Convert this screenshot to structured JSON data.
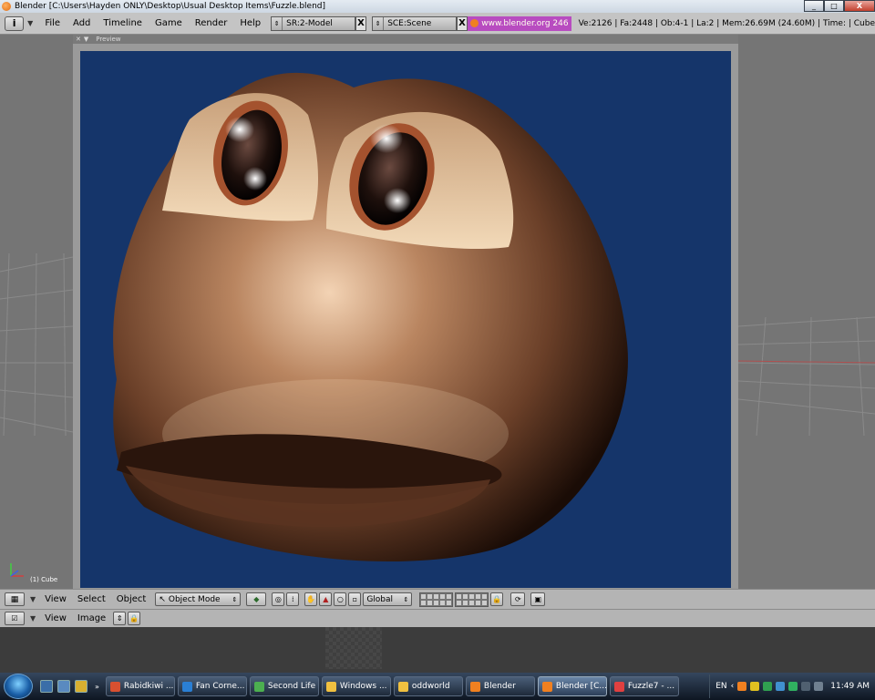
{
  "window": {
    "title": "Blender [C:\\Users\\Hayden ONLY\\Desktop\\Usual Desktop Items\\Fuzzle.blend]",
    "minimize_label": "_",
    "maximize_label": "□",
    "close_label": "X"
  },
  "header": {
    "menus": [
      "File",
      "Add",
      "Timeline",
      "Game",
      "Render",
      "Help"
    ],
    "screen_field": "SR:2-Model",
    "scene_field": "SCE:Scene",
    "x_label": "X",
    "url": "www.blender.org 246",
    "stats": "Ve:2126 | Fa:2448 | Ob:4-1 | La:2  | Mem:26.69M (24.60M)  | Time: | Cube"
  },
  "viewport": {
    "preview_label": "Preview",
    "object_label": "(1) Cube",
    "background_color": "#15356a"
  },
  "view3d_header": {
    "menus": [
      "View",
      "Select",
      "Object"
    ],
    "mode": "Object Mode",
    "orientation": "Global"
  },
  "image_header": {
    "menus": [
      "View",
      "Image"
    ]
  },
  "taskbar": {
    "buttons": [
      {
        "label": "Rabidkiwi ...",
        "icon_color": "#d85030"
      },
      {
        "label": "Fan Corne...",
        "icon_color": "#2a7fd4"
      },
      {
        "label": "Second Life",
        "icon_color": "#4caf50"
      },
      {
        "label": "Windows ...",
        "icon_color": "#f0c040"
      },
      {
        "label": "oddworld",
        "icon_color": "#f0c040"
      },
      {
        "label": "Blender",
        "icon_color": "#f08020"
      },
      {
        "label": "Blender [C...",
        "icon_color": "#f08020",
        "active": true
      },
      {
        "label": "Fuzzle7 - ...",
        "icon_color": "#e04040"
      }
    ],
    "language": "EN",
    "clock": "11:49 AM"
  }
}
